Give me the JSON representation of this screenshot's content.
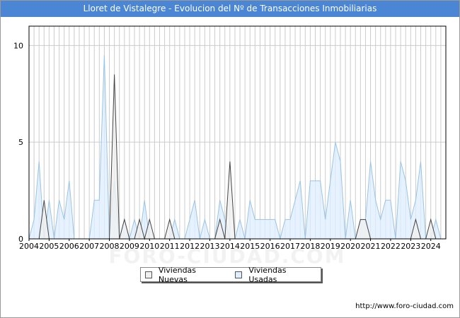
{
  "header": {
    "title": "Lloret de Vistalegre - Evolucion del Nº de Transacciones Inmobiliarias"
  },
  "footer": {
    "url": "http://www.foro-ciudad.com"
  },
  "watermark": {
    "text": "FORO-CIUDAD.COM"
  },
  "colors": {
    "title_bg": "#4a86d4",
    "nuevas_fill": "#f0f0f0",
    "nuevas_line": "#444444",
    "usadas_fill": "#ddeeff",
    "usadas_line": "#99c4e4",
    "grid": "#cccccc"
  },
  "chart_data": {
    "type": "area",
    "x_start": 2004,
    "points_per_year": 4,
    "xlim": [
      2004,
      2024.75
    ],
    "ylim": [
      0,
      11
    ],
    "y_ticks": [
      0,
      5,
      10
    ],
    "x_ticks": [
      "2004",
      "2005",
      "2006",
      "2007",
      "2008",
      "2009",
      "2010",
      "2011",
      "2012",
      "2013",
      "2014",
      "2015",
      "2016",
      "2017",
      "2018",
      "2019",
      "2020",
      "2021",
      "2022",
      "2023",
      "2024"
    ],
    "legend_position": "bottom-center",
    "grid": true,
    "series": [
      {
        "name": "Viviendas Nuevas",
        "values": [
          0,
          0,
          0,
          2,
          0,
          0,
          0,
          0,
          0,
          0,
          0,
          0,
          0,
          0,
          0,
          0,
          0,
          8.5,
          0,
          1,
          0,
          0,
          1,
          0,
          1,
          0,
          0,
          0,
          1,
          0,
          0,
          0,
          0,
          0,
          0,
          0,
          0,
          0,
          1,
          0,
          4,
          0,
          0,
          0,
          0,
          0,
          0,
          0,
          0,
          0,
          0,
          0,
          0,
          0,
          0,
          0,
          0,
          0,
          0,
          0,
          0,
          0,
          0,
          0,
          0,
          0,
          1,
          1,
          0,
          0,
          0,
          0,
          0,
          0,
          0,
          0,
          0,
          1,
          0,
          0,
          1,
          0,
          0
        ]
      },
      {
        "name": "Viviendas Usadas",
        "values": [
          0,
          1,
          4,
          0,
          2,
          0,
          2,
          1,
          3,
          0,
          0,
          0,
          0,
          2,
          2,
          9.5,
          0,
          3,
          0,
          1,
          0,
          1,
          0,
          2,
          0,
          0,
          0,
          0,
          0,
          1,
          0,
          0,
          1,
          2,
          0,
          1,
          0,
          0,
          2,
          1,
          0,
          0,
          1,
          0,
          2,
          1,
          1,
          1,
          1,
          1,
          0,
          1,
          1,
          2,
          3,
          0,
          3,
          3,
          3,
          1,
          3,
          5,
          4,
          0,
          2,
          0,
          1,
          1,
          4,
          2,
          1,
          2,
          2,
          0,
          4,
          3,
          1,
          2,
          4,
          0,
          0,
          1,
          0
        ]
      }
    ]
  }
}
